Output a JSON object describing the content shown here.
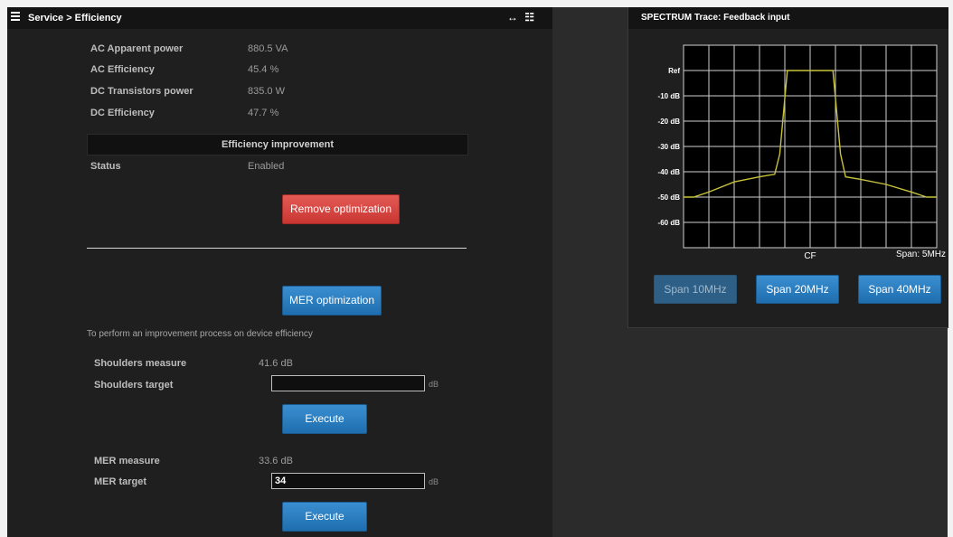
{
  "header": {
    "title": "Service > Efficiency",
    "controls": "↔ ☷"
  },
  "metrics": [
    {
      "label": "AC Apparent power",
      "value": "880.5 VA"
    },
    {
      "label": "AC Efficiency",
      "value": "45.4 %"
    },
    {
      "label": "DC Transistors power",
      "value": "835.0 W"
    },
    {
      "label": "DC Efficiency",
      "value": "47.7 %"
    }
  ],
  "efficiency_improvement": {
    "title": "Efficiency improvement",
    "status_label": "Status",
    "status_value": "Enabled",
    "remove_button": "Remove optimization"
  },
  "mer_optimization": {
    "button": "MER optimization",
    "description": "To perform an improvement process on device efficiency",
    "shoulders_measure_label": "Shoulders measure",
    "shoulders_measure_value": "41.6 dB",
    "shoulders_target_label": "Shoulders target",
    "shoulders_target_value": "",
    "shoulders_unit": "dB",
    "execute_1": "Execute",
    "mer_measure_label": "MER measure",
    "mer_measure_value": "33.6 dB",
    "mer_target_label": "MER target",
    "mer_target_value": "34",
    "mer_unit": "dB",
    "execute_2": "Execute"
  },
  "spectrum": {
    "title": "SPECTRUM Trace: Feedback input",
    "buttons": [
      "Span 10MHz",
      "Span 20MHz",
      "Span 40MHz"
    ]
  },
  "chart_data": {
    "type": "line",
    "title": "SPECTRUM Trace: Feedback input",
    "xlabel": "CF",
    "span_label": "Span: 5MHz",
    "y_tick_labels": [
      "Ref",
      "-10 dB",
      "-20 dB",
      "-30 dB",
      "-40 dB",
      "-50 dB",
      "-60 dB"
    ],
    "y_ticks": [
      0,
      -10,
      -20,
      -30,
      -40,
      -50,
      -60
    ],
    "ylim": [
      -70,
      10
    ],
    "xlim": [
      0,
      10
    ],
    "grid": true,
    "series": [
      {
        "color": "#c8c23a",
        "x": [
          0,
          0.4,
          1.0,
          2.0,
          3.0,
          3.6,
          3.8,
          4.1,
          5.0,
          5.9,
          6.2,
          6.4,
          7.0,
          8.0,
          9.0,
          9.6,
          10
        ],
        "y": [
          -50,
          -50,
          -48,
          -44,
          -42,
          -41,
          -33,
          0,
          0,
          0,
          -33,
          -42,
          -43,
          -45,
          -48,
          -50,
          -50
        ]
      }
    ],
    "colors": {
      "trace": "#c8c23a",
      "grid": "#cfcfcf",
      "background": "#000000"
    }
  },
  "colors": {
    "panel_bg": "#1f1f1f",
    "header_bg": "#141414",
    "accent_blue": "#2b7fc0",
    "danger_red": "#d7443f"
  }
}
